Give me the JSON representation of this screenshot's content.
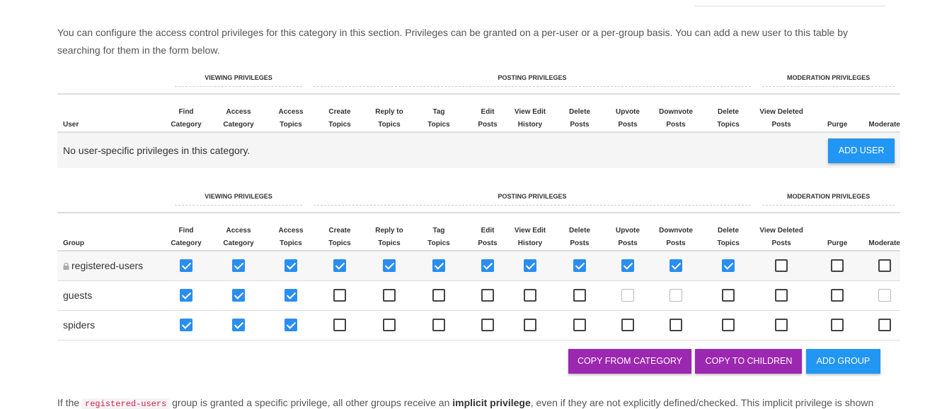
{
  "intro": "You can configure the access control privileges for this category in this section. Privileges can be granted on a per-user or a per-group basis. You can add a new user to this table by searching for them in the form below.",
  "categories": {
    "viewing": "Viewing Privileges",
    "posting": "Posting Privileges",
    "moderation": "Moderation Privileges"
  },
  "columns": [
    [
      "Find",
      "Category"
    ],
    [
      "Access",
      "Category"
    ],
    [
      "Access",
      "Topics"
    ],
    [
      "Create",
      "Topics"
    ],
    [
      "Reply to",
      "Topics"
    ],
    [
      "Tag",
      "Topics"
    ],
    [
      "Edit",
      "Posts"
    ],
    [
      "View Edit",
      "History"
    ],
    [
      "Delete",
      "Posts"
    ],
    [
      "Upvote",
      "Posts"
    ],
    [
      "Downvote",
      "Posts"
    ],
    [
      "Delete",
      "Topics"
    ],
    [
      "View Deleted",
      "Posts"
    ],
    [
      "",
      "Purge"
    ],
    [
      "",
      "Moderate"
    ]
  ],
  "user_table": {
    "first_col": "User",
    "empty_message": "No user-specific privileges in this category.",
    "add_user_label": "Add User"
  },
  "group_table": {
    "first_col": "Group",
    "rows": [
      {
        "name": "registered-users",
        "locked": true,
        "states": [
          "on",
          "on",
          "on",
          "on",
          "on",
          "on",
          "on",
          "on",
          "on",
          "on",
          "on",
          "on",
          "off",
          "off",
          "off"
        ]
      },
      {
        "name": "guests",
        "locked": false,
        "states": [
          "on",
          "on",
          "on",
          "off",
          "off",
          "off",
          "off",
          "off",
          "off",
          "dis",
          "dis",
          "off",
          "off",
          "off",
          "dis"
        ]
      },
      {
        "name": "spiders",
        "locked": false,
        "states": [
          "on",
          "on",
          "on",
          "off",
          "off",
          "off",
          "off",
          "off",
          "off",
          "off",
          "off",
          "off",
          "off",
          "off",
          "off"
        ]
      }
    ]
  },
  "buttons": {
    "copy_from_category": "Copy from Category",
    "copy_to_children": "Copy to Children",
    "add_group": "Add Group"
  },
  "footnote": {
    "prefix": "If the",
    "code": "registered-users",
    "middle": "group is granted a specific privilege, all other groups receive an",
    "bold": "implicit privilege",
    "suffix": ", even if they are not explicitly defined/checked. This implicit privilege is shown"
  },
  "colors": {
    "checkbox_on": "#2a8ef0",
    "btn_blue": "#2196f3",
    "btn_purple": "#9c27b0"
  }
}
